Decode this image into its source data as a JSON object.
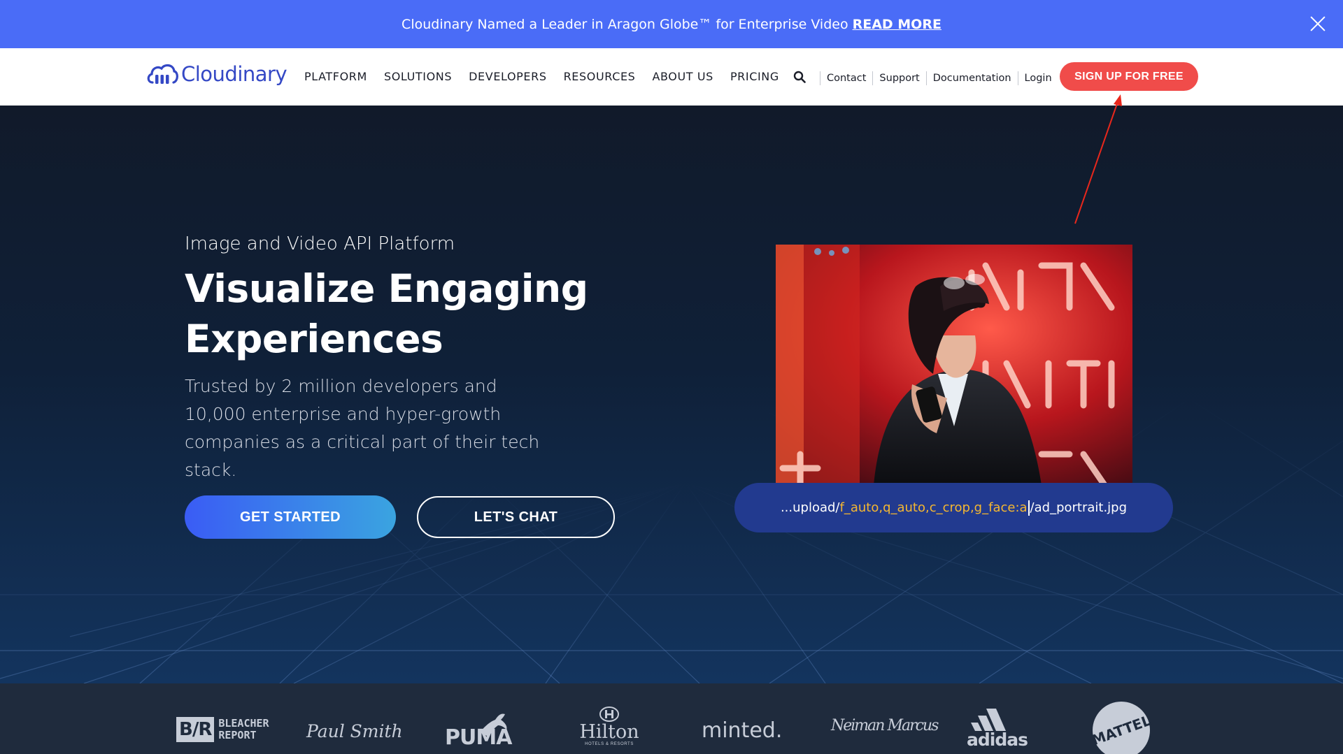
{
  "announcement": {
    "message": "Cloudinary Named a Leader in Aragon Globe™ for Enterprise Video",
    "link": "READ MORE"
  },
  "header": {
    "logo_text": "Cloudinary",
    "nav": [
      "PLATFORM",
      "SOLUTIONS",
      "DEVELOPERS",
      "RESOURCES",
      "ABOUT US",
      "PRICING"
    ],
    "utility_links": [
      "Contact",
      "Support",
      "Documentation",
      "Login"
    ],
    "signup_label": "SIGN UP FOR FREE"
  },
  "hero": {
    "eyebrow": "Image and Video API Platform",
    "headline_line1": "Visualize Engaging",
    "headline_line2": "Experiences",
    "subtitle": "Trusted by 2 million developers and 10,000 enterprise and hyper-growth companies as a critical part of their tech stack.",
    "primary_cta": "GET STARTED",
    "secondary_cta": "LET'S CHAT",
    "url": {
      "prefix": "...upload/",
      "params_before_caret": "f_auto,q_auto,c_crop,g_face:a",
      "suffix": "/ad_portrait.jpg"
    }
  },
  "brands": {
    "bleacher_line1": "BLEACHER",
    "bleacher_line2": "REPORT",
    "bleacher_mark": "B/R",
    "paul_smith": "Paul Smith",
    "puma": "PUMA",
    "hilton": "Hilton",
    "hilton_sub": "HOTELS & RESORTS",
    "minted": "minted.",
    "neiman": "Neiman Marcus",
    "adidas": "adidas",
    "mattel": "MATTEL"
  },
  "colors": {
    "announcement_bg": "#4a6cf7",
    "brand_blue": "#3448c5",
    "signup_red": "#f04c4a",
    "url_highlight": "#f5b731",
    "annotation_arrow": "#e8271c"
  }
}
